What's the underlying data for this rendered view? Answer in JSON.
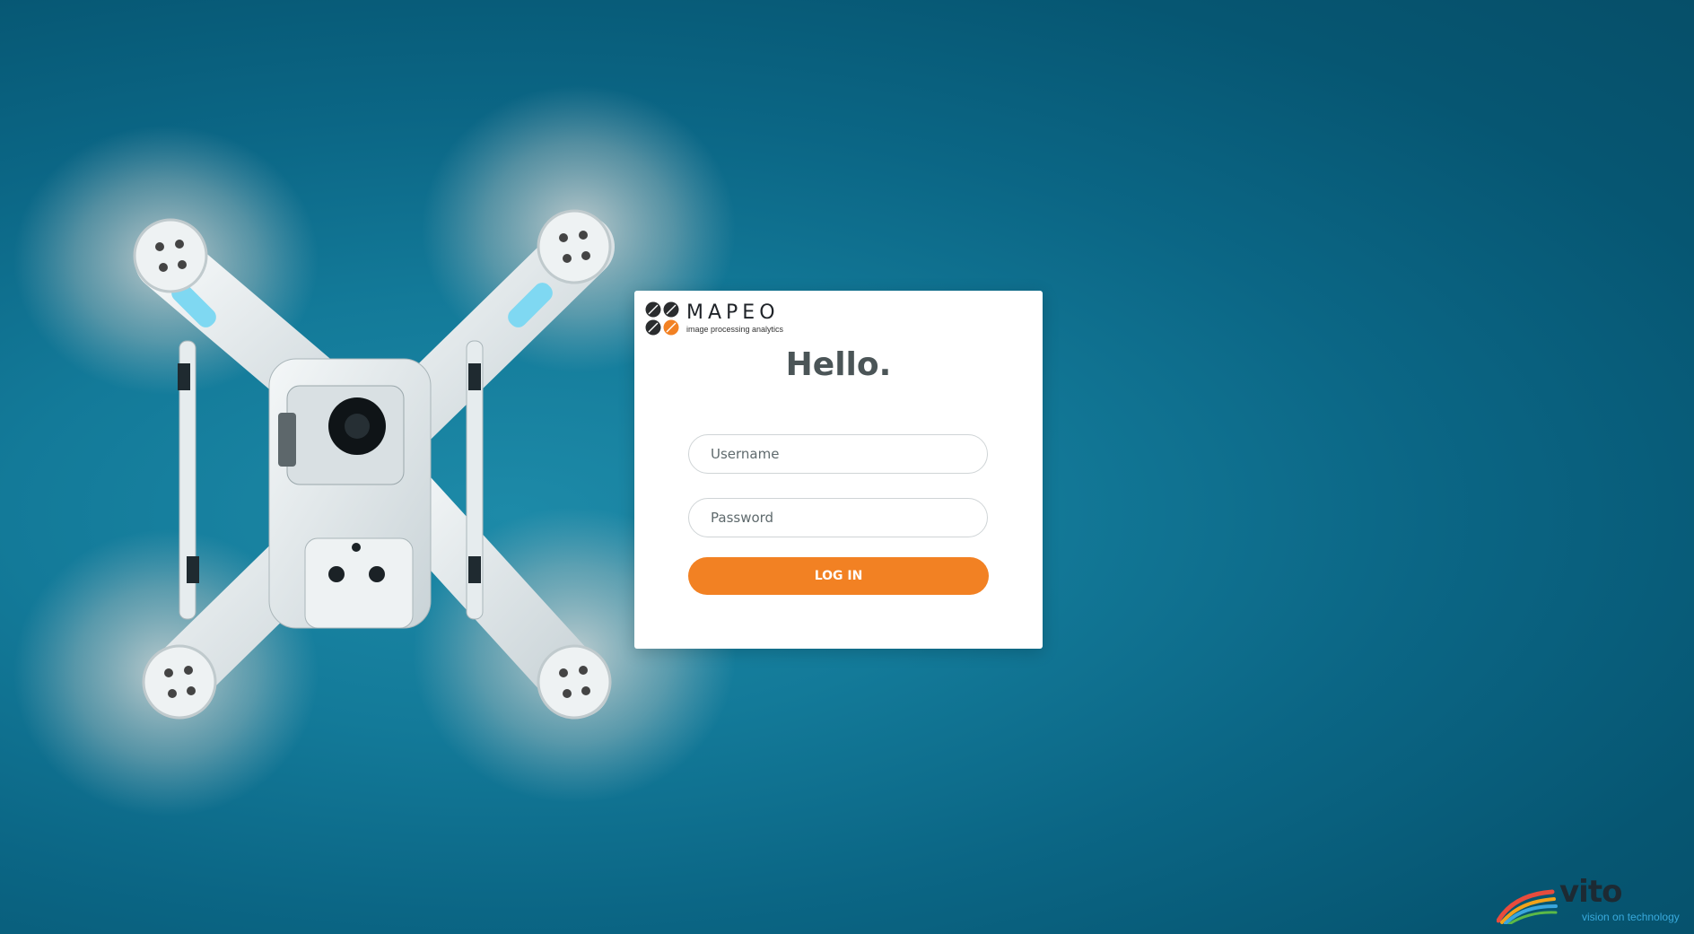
{
  "brand": {
    "name": "MAPEO",
    "tagline": "image processing analytics",
    "accent_color": "#f28123",
    "logo_icon": "quad-rotor-logo-icon"
  },
  "login": {
    "title": "Hello.",
    "username_placeholder": "Username",
    "password_placeholder": "Password",
    "submit_label": "LOG IN"
  },
  "partner": {
    "name": "vito",
    "tagline": "vision on technology",
    "logo_icon": "vito-swoosh-icon"
  },
  "background": {
    "image": "drone-photo",
    "color": "#0b6685"
  }
}
